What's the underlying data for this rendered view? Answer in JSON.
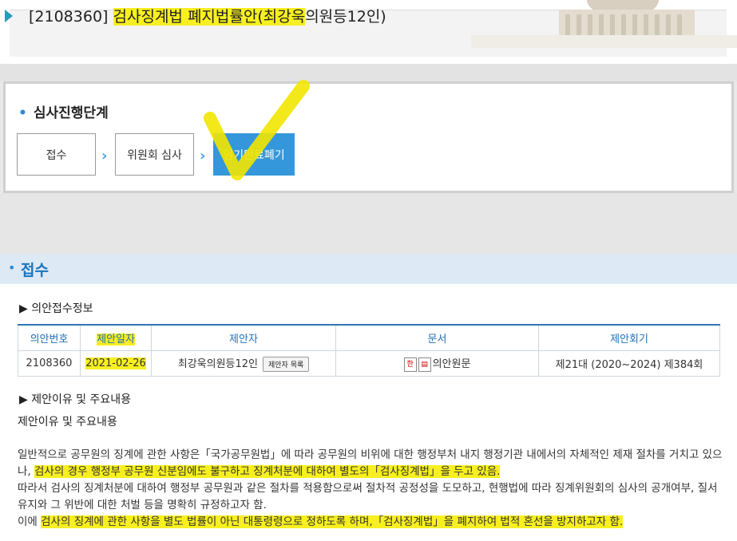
{
  "header": {
    "bill_no_label": "[2108360]",
    "title_highlighted": "검사징계법 폐지법률안(최강욱",
    "title_rest": "의원등12인)"
  },
  "progress": {
    "section_title": "심사진행단계",
    "steps": [
      "접수",
      "위원회 심사",
      "임기만료폐기"
    ],
    "active_step_index": 2
  },
  "reception": {
    "section_title": "접수",
    "info_heading": "▶ 의안접수정보",
    "table": {
      "headers": [
        "의안번호",
        "제안일자",
        "제안자",
        "문서",
        "제안회기"
      ],
      "row": {
        "bill_no": "2108360",
        "date": "2021-02-26",
        "proposer": "최강욱의원등12인",
        "proposer_button": "제안자 목록",
        "document": "의안원문",
        "session": "제21대 (2020~2024) 제384회"
      }
    },
    "reason_heading": "▶ 제안이유 및 주요내용",
    "reason_subtitle": "제안이유 및 주요내용",
    "paragraph1_a": "일반적으로 공무원의 징계에 관한 사항은「국가공무원법」에 따라 공무원의 비위에 대한 행정부처 내지 행정기관 내에서의 자체적인 제재 절차를 거치고 있으나, ",
    "paragraph1_b": "검사의 경우 행정부 공무원 신분임에도 불구하고 징계처분에 대하여 별도의「검사징계법」을 두고 있음.",
    "paragraph2": "따라서 검사의 징계처분에 대하여 행정부 공무원과 같은 절차를 적용함으로써 절차적 공정성을 도모하고, 현행법에 따라 징계위원회의 심사의 공개여부, 질서유지와 그 위반에 대한 처벌 등을 명확히 규정하고자 함.",
    "paragraph3_a": "이에 ",
    "paragraph3_b": "검사의 징계에 관한 사항을 별도 법률이 아닌 대통령령으로 정하도록 하며,「검사징계법」을 폐지하여 법적 혼선을 방지하고자 함."
  },
  "colors": {
    "accent": "#3597db",
    "highlight": "#f7ef1f",
    "title_blue": "#1a74c0"
  }
}
